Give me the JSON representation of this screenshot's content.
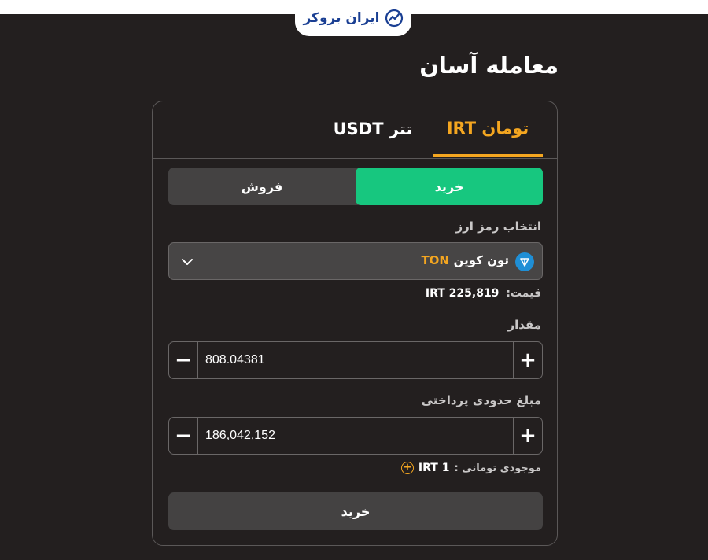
{
  "brand": {
    "name": "ایران بروکر"
  },
  "page": {
    "title": "معامله آسان"
  },
  "tabs": [
    {
      "label": "تومان IRT",
      "active": true
    },
    {
      "label": "تتر USDT",
      "active": false
    }
  ],
  "trade_toggle": {
    "buy_label": "خرید",
    "sell_label": "فروش",
    "selected": "خرید"
  },
  "coin_select": {
    "label": "انتخاب رمز ارز",
    "coin_name": "تون کوین",
    "coin_symbol": "TON",
    "icon": "ton-coin-icon"
  },
  "price": {
    "label": "قیمت:",
    "value": "IRT 225,819"
  },
  "amount": {
    "label": "مقدار",
    "value": "808.04381"
  },
  "payment": {
    "label": "مبلغ حدودی پرداختی",
    "value": "186,042,152"
  },
  "balance": {
    "label": "موجودی تومانی :",
    "value": "IRT 1"
  },
  "submit": {
    "label": "خرید"
  },
  "colors": {
    "accent": "#f4a620",
    "buy": "#17c77f",
    "background": "#231f1f",
    "brand": "#1a3f93"
  }
}
